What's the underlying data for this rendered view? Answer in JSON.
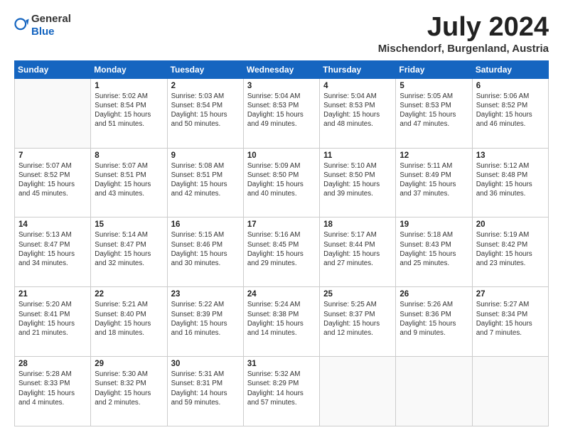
{
  "header": {
    "logo_general": "General",
    "logo_blue": "Blue",
    "month_title": "July 2024",
    "location": "Mischendorf, Burgenland, Austria"
  },
  "weekdays": [
    "Sunday",
    "Monday",
    "Tuesday",
    "Wednesday",
    "Thursday",
    "Friday",
    "Saturday"
  ],
  "weeks": [
    [
      {
        "day": "",
        "info": ""
      },
      {
        "day": "1",
        "info": "Sunrise: 5:02 AM\nSunset: 8:54 PM\nDaylight: 15 hours\nand 51 minutes."
      },
      {
        "day": "2",
        "info": "Sunrise: 5:03 AM\nSunset: 8:54 PM\nDaylight: 15 hours\nand 50 minutes."
      },
      {
        "day": "3",
        "info": "Sunrise: 5:04 AM\nSunset: 8:53 PM\nDaylight: 15 hours\nand 49 minutes."
      },
      {
        "day": "4",
        "info": "Sunrise: 5:04 AM\nSunset: 8:53 PM\nDaylight: 15 hours\nand 48 minutes."
      },
      {
        "day": "5",
        "info": "Sunrise: 5:05 AM\nSunset: 8:53 PM\nDaylight: 15 hours\nand 47 minutes."
      },
      {
        "day": "6",
        "info": "Sunrise: 5:06 AM\nSunset: 8:52 PM\nDaylight: 15 hours\nand 46 minutes."
      }
    ],
    [
      {
        "day": "7",
        "info": "Sunrise: 5:07 AM\nSunset: 8:52 PM\nDaylight: 15 hours\nand 45 minutes."
      },
      {
        "day": "8",
        "info": "Sunrise: 5:07 AM\nSunset: 8:51 PM\nDaylight: 15 hours\nand 43 minutes."
      },
      {
        "day": "9",
        "info": "Sunrise: 5:08 AM\nSunset: 8:51 PM\nDaylight: 15 hours\nand 42 minutes."
      },
      {
        "day": "10",
        "info": "Sunrise: 5:09 AM\nSunset: 8:50 PM\nDaylight: 15 hours\nand 40 minutes."
      },
      {
        "day": "11",
        "info": "Sunrise: 5:10 AM\nSunset: 8:50 PM\nDaylight: 15 hours\nand 39 minutes."
      },
      {
        "day": "12",
        "info": "Sunrise: 5:11 AM\nSunset: 8:49 PM\nDaylight: 15 hours\nand 37 minutes."
      },
      {
        "day": "13",
        "info": "Sunrise: 5:12 AM\nSunset: 8:48 PM\nDaylight: 15 hours\nand 36 minutes."
      }
    ],
    [
      {
        "day": "14",
        "info": "Sunrise: 5:13 AM\nSunset: 8:47 PM\nDaylight: 15 hours\nand 34 minutes."
      },
      {
        "day": "15",
        "info": "Sunrise: 5:14 AM\nSunset: 8:47 PM\nDaylight: 15 hours\nand 32 minutes."
      },
      {
        "day": "16",
        "info": "Sunrise: 5:15 AM\nSunset: 8:46 PM\nDaylight: 15 hours\nand 30 minutes."
      },
      {
        "day": "17",
        "info": "Sunrise: 5:16 AM\nSunset: 8:45 PM\nDaylight: 15 hours\nand 29 minutes."
      },
      {
        "day": "18",
        "info": "Sunrise: 5:17 AM\nSunset: 8:44 PM\nDaylight: 15 hours\nand 27 minutes."
      },
      {
        "day": "19",
        "info": "Sunrise: 5:18 AM\nSunset: 8:43 PM\nDaylight: 15 hours\nand 25 minutes."
      },
      {
        "day": "20",
        "info": "Sunrise: 5:19 AM\nSunset: 8:42 PM\nDaylight: 15 hours\nand 23 minutes."
      }
    ],
    [
      {
        "day": "21",
        "info": "Sunrise: 5:20 AM\nSunset: 8:41 PM\nDaylight: 15 hours\nand 21 minutes."
      },
      {
        "day": "22",
        "info": "Sunrise: 5:21 AM\nSunset: 8:40 PM\nDaylight: 15 hours\nand 18 minutes."
      },
      {
        "day": "23",
        "info": "Sunrise: 5:22 AM\nSunset: 8:39 PM\nDaylight: 15 hours\nand 16 minutes."
      },
      {
        "day": "24",
        "info": "Sunrise: 5:24 AM\nSunset: 8:38 PM\nDaylight: 15 hours\nand 14 minutes."
      },
      {
        "day": "25",
        "info": "Sunrise: 5:25 AM\nSunset: 8:37 PM\nDaylight: 15 hours\nand 12 minutes."
      },
      {
        "day": "26",
        "info": "Sunrise: 5:26 AM\nSunset: 8:36 PM\nDaylight: 15 hours\nand 9 minutes."
      },
      {
        "day": "27",
        "info": "Sunrise: 5:27 AM\nSunset: 8:34 PM\nDaylight: 15 hours\nand 7 minutes."
      }
    ],
    [
      {
        "day": "28",
        "info": "Sunrise: 5:28 AM\nSunset: 8:33 PM\nDaylight: 15 hours\nand 4 minutes."
      },
      {
        "day": "29",
        "info": "Sunrise: 5:30 AM\nSunset: 8:32 PM\nDaylight: 15 hours\nand 2 minutes."
      },
      {
        "day": "30",
        "info": "Sunrise: 5:31 AM\nSunset: 8:31 PM\nDaylight: 14 hours\nand 59 minutes."
      },
      {
        "day": "31",
        "info": "Sunrise: 5:32 AM\nSunset: 8:29 PM\nDaylight: 14 hours\nand 57 minutes."
      },
      {
        "day": "",
        "info": ""
      },
      {
        "day": "",
        "info": ""
      },
      {
        "day": "",
        "info": ""
      }
    ]
  ]
}
